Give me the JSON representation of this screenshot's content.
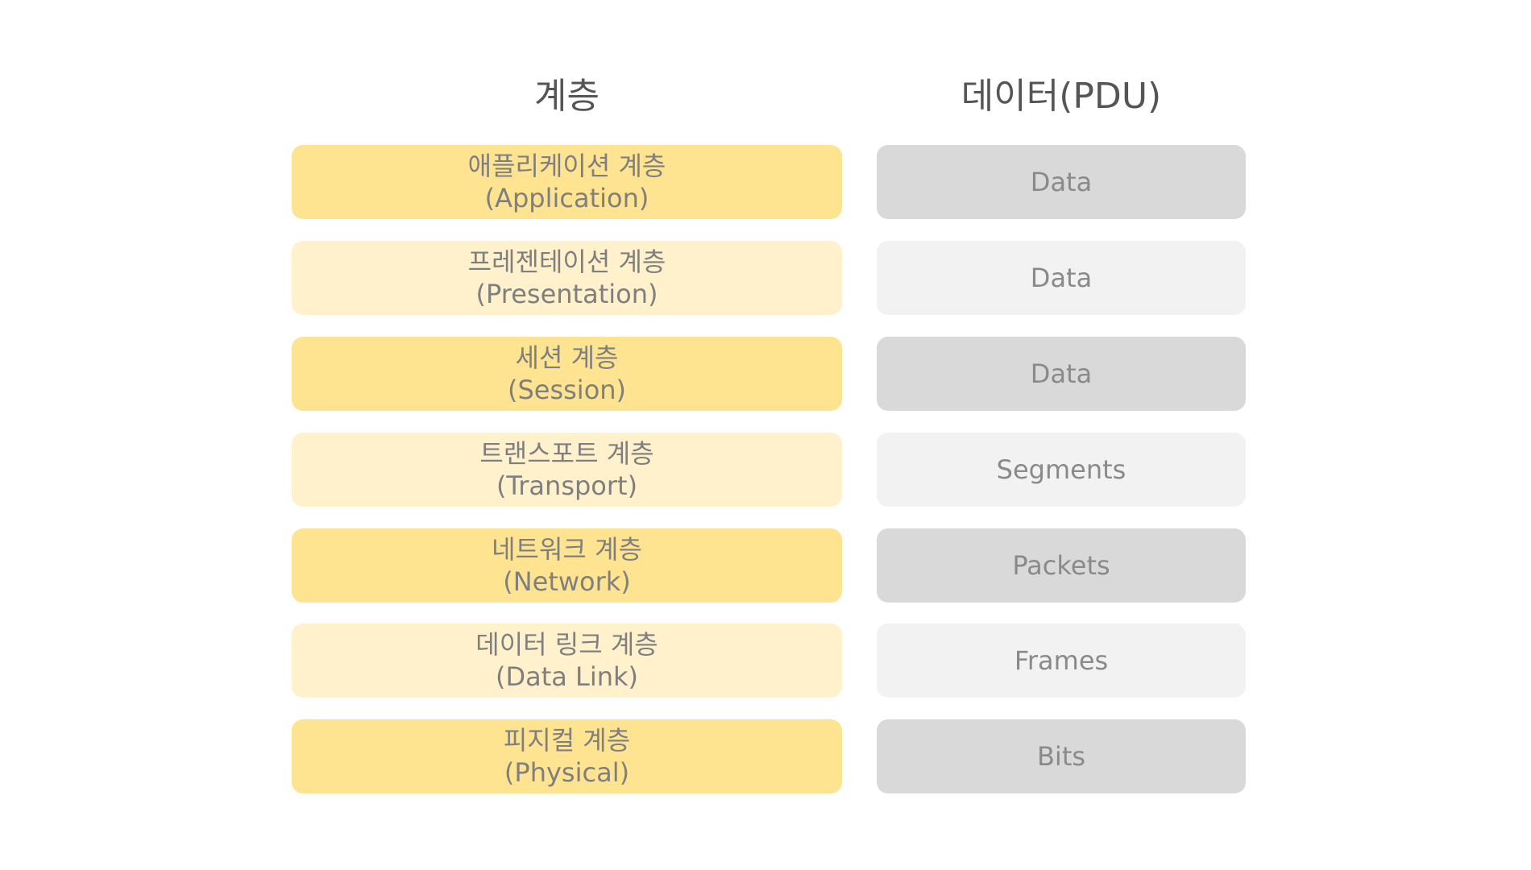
{
  "headers": {
    "layer": "계층",
    "pdu": "데이터(PDU)"
  },
  "colors": {
    "layer_dark": "#fee391",
    "layer_light": "#fef1cb",
    "pdu_dark": "#d9d9d9",
    "pdu_light": "#f2f2f2",
    "text": "#7f7f7f"
  },
  "layers": [
    {
      "name_ko": "애플리케이션 계층",
      "name_en": "(Application)",
      "pdu": "Data"
    },
    {
      "name_ko": "프레젠테이션 계층",
      "name_en": "(Presentation)",
      "pdu": "Data"
    },
    {
      "name_ko": "세션 계층",
      "name_en": "(Session)",
      "pdu": "Data"
    },
    {
      "name_ko": "트랜스포트 계층",
      "name_en": "(Transport)",
      "pdu": "Segments"
    },
    {
      "name_ko": "네트워크 계층",
      "name_en": "(Network)",
      "pdu": "Packets"
    },
    {
      "name_ko": "데이터 링크 계층",
      "name_en": "(Data Link)",
      "pdu": "Frames"
    },
    {
      "name_ko": "피지컬 계층",
      "name_en": "(Physical)",
      "pdu": "Bits"
    }
  ]
}
